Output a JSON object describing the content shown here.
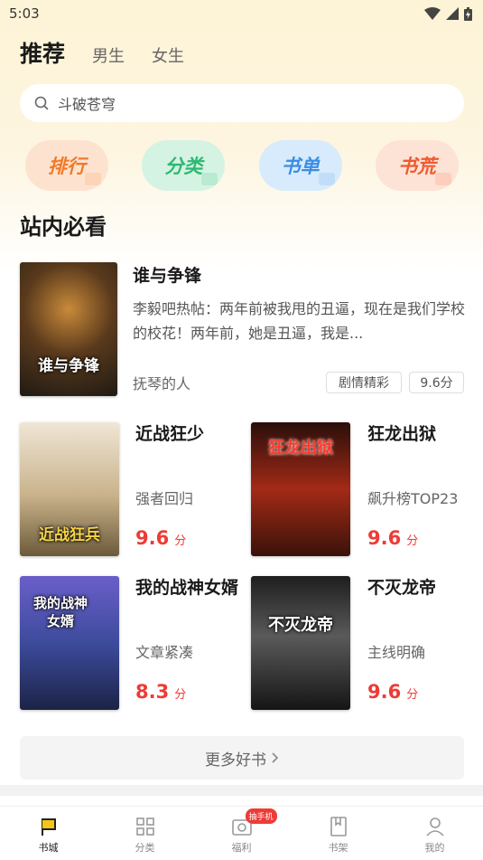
{
  "status": {
    "time": "5:03"
  },
  "tabs": [
    {
      "label": "推荐",
      "active": true
    },
    {
      "label": "男生",
      "active": false
    },
    {
      "label": "女生",
      "active": false
    }
  ],
  "search": {
    "placeholder": "斗破苍穹",
    "icon": "search-icon"
  },
  "quick_actions": [
    {
      "label": "排行",
      "color": "#f07a2b"
    },
    {
      "label": "分类",
      "color": "#2cb872"
    },
    {
      "label": "书单",
      "color": "#3a8ee6"
    },
    {
      "label": "书荒",
      "color": "#ef5a2f"
    }
  ],
  "section": {
    "title": "站内必看"
  },
  "featured": {
    "title": "谁与争锋",
    "cover_text": "谁与争锋",
    "description": "李毅吧热帖：两年前被我甩的丑逼，现在是我们学校的校花！两年前，她是丑逼，我是...",
    "author": "抚琴的人",
    "tag": "剧情精彩",
    "score": "9.6分"
  },
  "books": [
    {
      "title": "近战狂少",
      "cover_text": "近战狂兵",
      "subtitle": "强者回归",
      "score": "9.6",
      "unit": "分"
    },
    {
      "title": "狂龙出狱",
      "cover_text": "狂龙出狱",
      "subtitle": "飙升榜TOP23",
      "score": "9.6",
      "unit": "分"
    },
    {
      "title": "我的战神女婿",
      "cover_text": "我的战神女婿",
      "subtitle": "文章紧凑",
      "score": "8.3",
      "unit": "分"
    },
    {
      "title": "不灭龙帝",
      "cover_text": "不灭龙帝",
      "subtitle": "主线明确",
      "score": "9.6",
      "unit": "分"
    }
  ],
  "more": {
    "label": "更多好书"
  },
  "bottom_nav": [
    {
      "label": "书城",
      "icon": "bookstore-flag-icon",
      "active": true
    },
    {
      "label": "分类",
      "icon": "grid-icon",
      "active": false
    },
    {
      "label": "福利",
      "icon": "gift-icon",
      "active": false,
      "badge": "抽手机"
    },
    {
      "label": "书架",
      "icon": "bookshelf-icon",
      "active": false
    },
    {
      "label": "我的",
      "icon": "profile-icon",
      "active": false
    }
  ]
}
